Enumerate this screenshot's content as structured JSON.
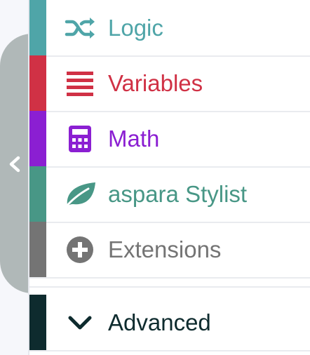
{
  "toolbox": {
    "categories": [
      {
        "label": "Logic",
        "color": "#4fa5a8",
        "icon": "shuffle-icon"
      },
      {
        "label": "Variables",
        "color": "#d03145",
        "icon": "list-icon"
      },
      {
        "label": "Math",
        "color": "#8b1fd2",
        "icon": "calculator-icon"
      },
      {
        "label": "aspara Stylist",
        "color": "#489786",
        "icon": "leaf-icon"
      },
      {
        "label": "Extensions",
        "color": "#747474",
        "icon": "plus-circle-icon"
      }
    ],
    "advanced": {
      "label": "Advanced",
      "color": "#0e2b2e",
      "icon": "chevron-down-icon"
    }
  },
  "collapse": {
    "icon": "chevron-left-icon",
    "color": "#b0b8b8"
  }
}
